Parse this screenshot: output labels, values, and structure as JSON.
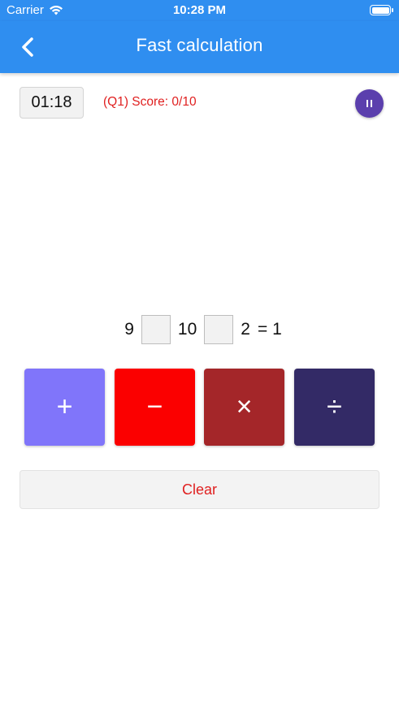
{
  "status_bar": {
    "carrier": "Carrier",
    "time": "10:28 PM"
  },
  "nav": {
    "title": "Fast calculation",
    "back_icon": "chevron-left-icon"
  },
  "game": {
    "timer": "01:18",
    "score": "(Q1) Score: 0/10",
    "pause_icon": "pause-icon",
    "equation": {
      "a": "9",
      "b": "10",
      "c": "2",
      "result": "= 1"
    }
  },
  "operators": [
    {
      "label": "+",
      "color": "#8075fa"
    },
    {
      "label": "−",
      "color": "#fb0000"
    },
    {
      "label": "×",
      "color": "#a42629"
    },
    {
      "label": "÷",
      "color": "#332a66"
    }
  ],
  "clear_label": "Clear",
  "colors": {
    "primary": "#2f8ef0",
    "accent": "#e02020",
    "pause": "#5b3fad"
  }
}
